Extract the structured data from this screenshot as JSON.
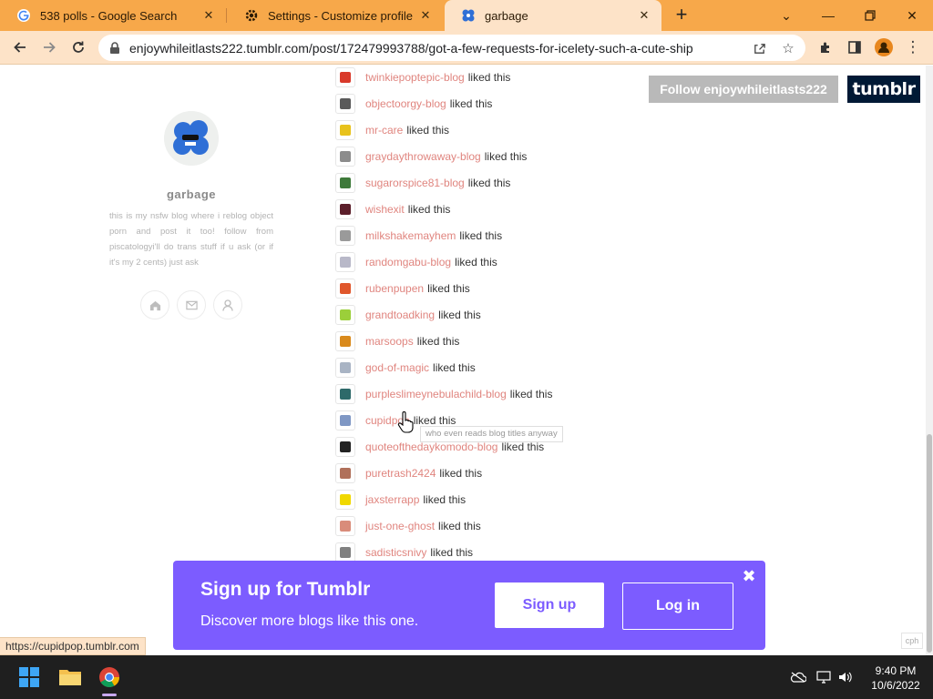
{
  "browser": {
    "tabs": [
      {
        "title": "538 polls - Google Search",
        "icon": "google-icon"
      },
      {
        "title": "Settings - Customize profile",
        "icon": "gear-icon"
      },
      {
        "title": "garbage",
        "icon": "blog-avatar-icon"
      }
    ],
    "active_tab": 2,
    "url": "enjoywhileitlasts222.tumblr.com/post/172479993788/got-a-few-requests-for-icelety-such-a-cute-ship",
    "status_url": "https://cupidpop.tumblr.com"
  },
  "sidebar": {
    "blog_name": "garbage",
    "description": "this is my nsfw blog where i reblog object porn and post it too! follow from piscatologyi'll do trans stuff if u ask (or if it's my 2 cents) just ask",
    "icons": [
      "home-icon",
      "mail-icon",
      "user-icon"
    ]
  },
  "header": {
    "follow_label": "Follow enjoywhileitlasts222",
    "logo_label": "tumblr"
  },
  "notes": [
    {
      "user": "twinkiepoptepic-blog",
      "action": "liked this",
      "color": "#d93a2b"
    },
    {
      "user": "objectoorgy-blog",
      "action": "liked this",
      "color": "#5a5a5a"
    },
    {
      "user": "mr-care",
      "action": "liked this",
      "color": "#e8c21c"
    },
    {
      "user": "graydaythrowaway-blog",
      "action": "liked this",
      "color": "#8c8c8c"
    },
    {
      "user": "sugarorspice81-blog",
      "action": "liked this",
      "color": "#3e7a3a"
    },
    {
      "user": "wishexit",
      "action": "liked this",
      "color": "#5b1e2a"
    },
    {
      "user": "milkshakemayhem",
      "action": "liked this",
      "color": "#9a9a9a"
    },
    {
      "user": "randomgabu-blog",
      "action": "liked this",
      "color": "#b8b8c8"
    },
    {
      "user": "rubenpupen",
      "action": "liked this",
      "color": "#e0572c"
    },
    {
      "user": "grandtoadking",
      "action": "liked this",
      "color": "#9bcf3a"
    },
    {
      "user": "marsoops",
      "action": "liked this",
      "color": "#d98a1c"
    },
    {
      "user": "god-of-magic",
      "action": "liked this",
      "color": "#a9b4c4"
    },
    {
      "user": "purpleslimeynebulachild-blog",
      "action": "liked this",
      "color": "#2e6a6a"
    },
    {
      "user": "cupidpop",
      "action": "liked this",
      "color": "#7f97c4"
    },
    {
      "user": "quoteofthedaykomodo-blog",
      "action": "liked this",
      "color": "#222222"
    },
    {
      "user": "puretrash2424",
      "action": "liked this",
      "color": "#b0705a"
    },
    {
      "user": "jaxsterrapp",
      "action": "liked this",
      "color": "#f0d800"
    },
    {
      "user": "just-one-ghost",
      "action": "liked this",
      "color": "#d98c7a"
    },
    {
      "user": "sadisticsnivy",
      "action": "liked this",
      "color": "#808080"
    }
  ],
  "tooltip": "who even reads blog titles anyway",
  "signup": {
    "title": "Sign up for Tumblr",
    "subtitle": "Discover more blogs like this one.",
    "signup_label": "Sign up",
    "login_label": "Log in"
  },
  "corner_badge": "cph",
  "taskbar": {
    "time": "9:40 PM",
    "date": "10/6/2022"
  },
  "colors": {
    "chrome_accent": "#f7a84a",
    "tumblr_navy": "#001935",
    "signup_purple": "#7c5cff",
    "username_pink": "#e0857f"
  }
}
